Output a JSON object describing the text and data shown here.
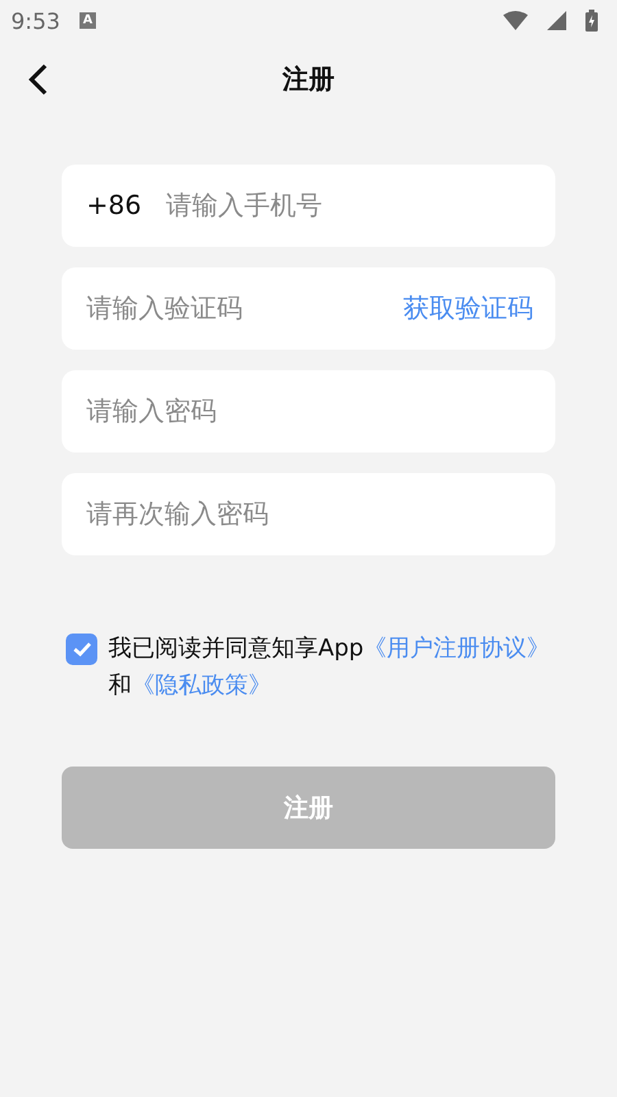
{
  "status_bar": {
    "time": "9:53",
    "notification": "A"
  },
  "header": {
    "title": "注册"
  },
  "fields": [
    {
      "kind": "phone",
      "prefix": "+86",
      "placeholder": "请输入手机号"
    },
    {
      "kind": "code",
      "placeholder": "请输入验证码",
      "action": "获取验证码"
    },
    {
      "kind": "password",
      "placeholder": "请输入密码"
    },
    {
      "kind": "password",
      "placeholder": "请再次输入密码"
    }
  ],
  "agreement": {
    "checked": true,
    "parts": [
      {
        "kind": "text",
        "text": "我已阅读并同意知享App"
      },
      {
        "kind": "link",
        "text": "《用户注册协议》"
      },
      {
        "kind": "text",
        "text": "和"
      },
      {
        "kind": "link",
        "text": "《隐私政策》"
      }
    ]
  },
  "submit": {
    "label": "注册",
    "disabled": true
  }
}
